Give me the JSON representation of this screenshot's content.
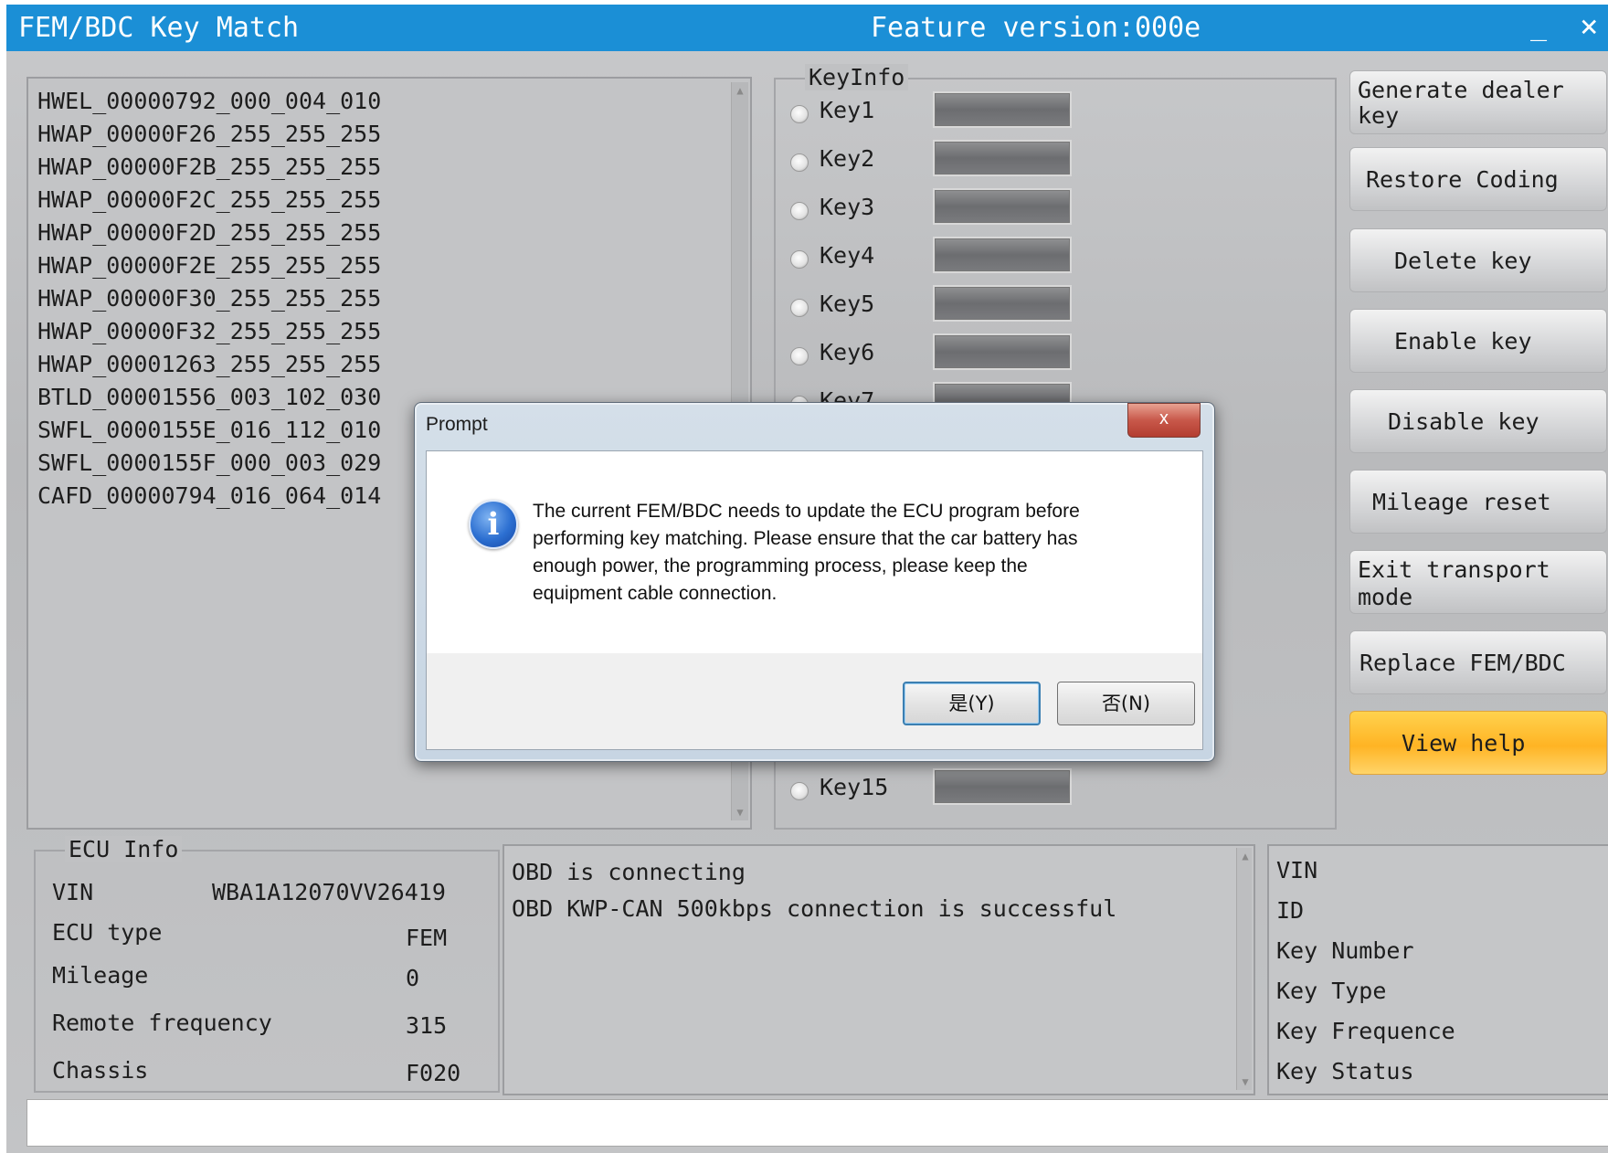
{
  "titlebar": {
    "title": "FEM/BDC Key Match",
    "feature_version": "Feature version:000e",
    "minimize": "_",
    "close": "×"
  },
  "module_list": [
    "HWEL_00000792_000_004_010",
    "HWAP_00000F26_255_255_255",
    "HWAP_00000F2B_255_255_255",
    "HWAP_00000F2C_255_255_255",
    "HWAP_00000F2D_255_255_255",
    "HWAP_00000F2E_255_255_255",
    "HWAP_00000F30_255_255_255",
    "HWAP_00000F32_255_255_255",
    "HWAP_00001263_255_255_255",
    "BTLD_00001556_003_102_030",
    "SWFL_0000155E_016_112_010",
    "SWFL_0000155F_000_003_029",
    "CAFD_00000794_016_064_014"
  ],
  "keyinfo": {
    "title": "KeyInfo",
    "keys": [
      {
        "label": "Key1"
      },
      {
        "label": "Key2"
      },
      {
        "label": "Key3"
      },
      {
        "label": "Key4"
      },
      {
        "label": "Key5"
      },
      {
        "label": "Key6"
      },
      {
        "label": "Key7"
      },
      {
        "label": "Key15"
      }
    ]
  },
  "actions": {
    "generate_dealer_key": [
      "Generate dealer",
      "key"
    ],
    "restore_coding": "Restore Coding",
    "delete_key": "Delete key",
    "enable_key": "Enable key",
    "disable_key": "Disable key",
    "mileage_reset": "Mileage reset",
    "exit_transport_mode": [
      "Exit transport",
      "mode"
    ],
    "replace_fem_bdc": "Replace FEM/BDC",
    "view_help": "View help"
  },
  "ecu_info": {
    "title": "ECU Info",
    "vin_label": "VIN",
    "vin_value": "WBA1A12070VV26419",
    "ecu_type_label": "ECU type",
    "ecu_type_value": "FEM",
    "mileage_label": "Mileage",
    "mileage_value": "0",
    "remote_frequency_label": "Remote frequency",
    "remote_frequency_value": "315",
    "chassis_label": "Chassis",
    "chassis_value": "F020"
  },
  "log": [
    "OBD is connecting",
    "OBD KWP-CAN 500kbps connection is successful"
  ],
  "key_details": [
    "VIN",
    "ID",
    "Key Number",
    "Key Type",
    "Key Frequence",
    "Key Status"
  ],
  "dialog": {
    "title": "Prompt",
    "close": "x",
    "message_lines": [
      "The current FEM/BDC needs to update the ECU program before",
      "performing key matching. Please ensure that the car battery has",
      "enough power, the programming process, please keep the",
      "equipment cable connection."
    ],
    "yes_label": "是(Y)",
    "no_label": "否(N)",
    "icon": "info-icon"
  },
  "colors": {
    "titlebar": "#1b8fd6",
    "help_button": "#ffb424",
    "window_bg": "#c3c4c6"
  }
}
